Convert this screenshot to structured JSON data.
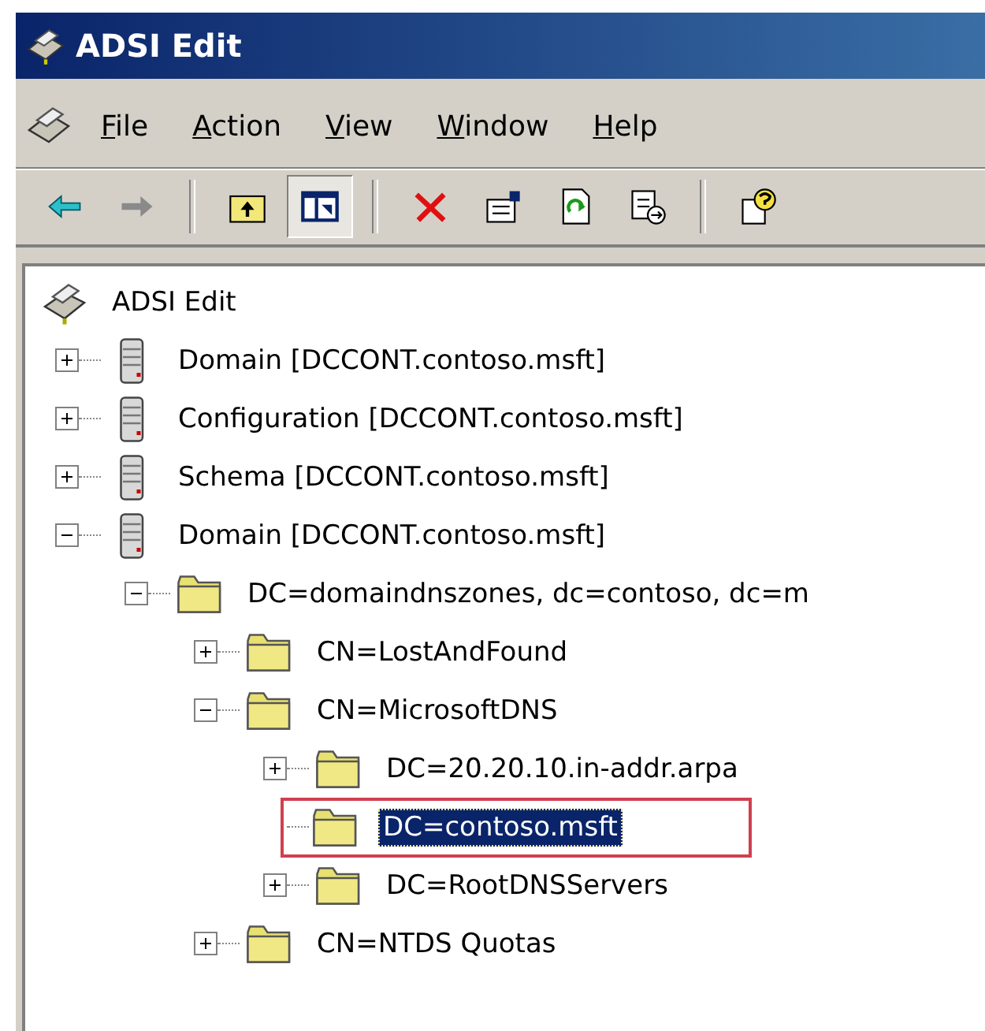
{
  "window": {
    "title": "ADSI Edit"
  },
  "menu": [
    {
      "label": "File",
      "access_key_underlined": true
    },
    {
      "label": "Action",
      "access_key_underlined": true
    },
    {
      "label": "View",
      "access_key_underlined": true
    },
    {
      "label": "Window",
      "access_key_underlined": true
    },
    {
      "label": "Help",
      "access_key_underlined": true
    }
  ],
  "toolbar": [
    {
      "kind": "back",
      "disabled": false
    },
    {
      "kind": "forward",
      "disabled": true
    },
    {
      "kind": "separator"
    },
    {
      "kind": "up",
      "pressed": false
    },
    {
      "kind": "tree",
      "pressed": true
    },
    {
      "kind": "separator"
    },
    {
      "kind": "delete",
      "pressed": false
    },
    {
      "kind": "properties",
      "pressed": false
    },
    {
      "kind": "refresh",
      "pressed": false
    },
    {
      "kind": "export",
      "pressed": false
    },
    {
      "kind": "separator"
    },
    {
      "kind": "help",
      "pressed": false
    }
  ],
  "tree": {
    "label": "ADSI Edit",
    "kind": "root",
    "selected": false,
    "children": [
      {
        "label": "Domain [DCCONT.contoso.msft]",
        "kind": "server",
        "expanded": false,
        "selected": false
      },
      {
        "label": "Configuration [DCCONT.contoso.msft]",
        "kind": "server",
        "expanded": false,
        "selected": false
      },
      {
        "label": "Schema [DCCONT.contoso.msft]",
        "kind": "server",
        "expanded": false,
        "selected": false
      },
      {
        "label": "Domain [DCCONT.contoso.msft]",
        "kind": "server",
        "expanded": true,
        "selected": false,
        "children": [
          {
            "label": "DC=domaindnszones, dc=contoso, dc=m",
            "kind": "folder",
            "expanded": true,
            "selected": false,
            "children": [
              {
                "label": "CN=LostAndFound",
                "kind": "folder",
                "expanded": false,
                "selected": false
              },
              {
                "label": "CN=MicrosoftDNS",
                "kind": "folder",
                "expanded": true,
                "selected": false,
                "children": [
                  {
                    "label": "DC=20.20.10.in-addr.arpa",
                    "kind": "folder",
                    "expanded": false,
                    "selected": false
                  },
                  {
                    "label": "DC=contoso.msft",
                    "kind": "folder",
                    "selected": true,
                    "highlighted": true
                  },
                  {
                    "label": "DC=RootDNSServers",
                    "kind": "folder",
                    "expanded": false,
                    "selected": false
                  }
                ]
              },
              {
                "label": "CN=NTDS Quotas",
                "kind": "folder",
                "expanded": false,
                "selected": false
              }
            ]
          }
        ]
      }
    ]
  }
}
